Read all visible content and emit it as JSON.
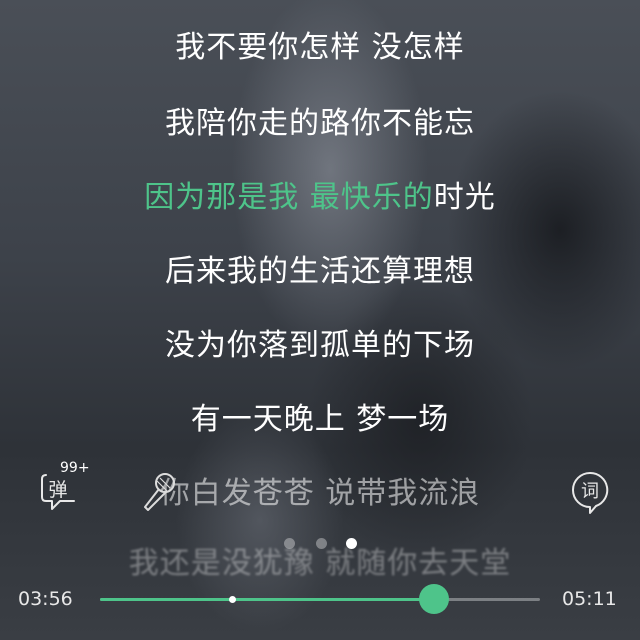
{
  "lyrics": {
    "lines": [
      "我不要你怎样 没怎样",
      "我陪你走的路你不能忘",
      "因为那是我 最快乐的时光",
      "后来我的生活还算理想",
      "没为你落到孤单的下场",
      "有一天晚上 梦一场",
      "你白发苍苍 说带我流浪",
      "我还是没犹豫 就随你去天堂"
    ],
    "current_sung": "因为那是我 最快乐的",
    "current_rest": "时光"
  },
  "danmu": {
    "label": "弹",
    "badge": "99+"
  },
  "lyric_button": {
    "label": "词"
  },
  "pager": {
    "count": 3,
    "active_index": 2
  },
  "player": {
    "elapsed": "03:56",
    "duration": "05:11",
    "progress": 0.7588,
    "marker_progress": 0.3
  },
  "colors": {
    "accent": "#4ec48a"
  },
  "icons": {
    "mic": "microphone-icon",
    "danmu": "danmu-bubble-icon",
    "lyric": "lyric-bubble-icon"
  }
}
